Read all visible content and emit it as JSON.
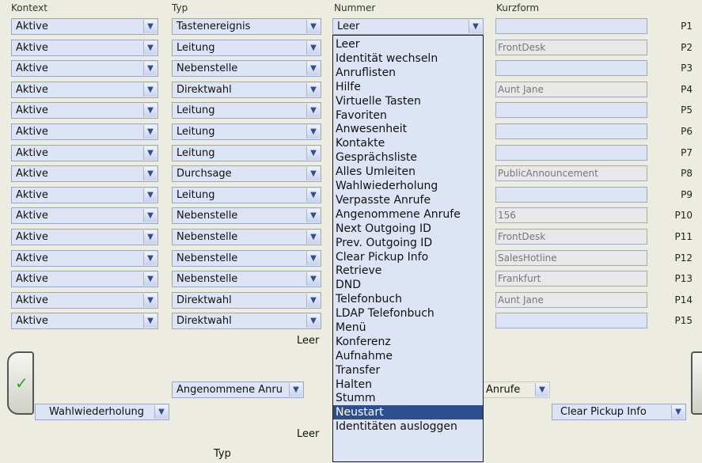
{
  "headers": {
    "kontext": "Kontext",
    "typ": "Typ",
    "nummer": "Nummer",
    "kurzform": "Kurzform"
  },
  "rows": [
    {
      "kontext": "Aktive",
      "typ": "Tastenereignis",
      "kurzform": "",
      "p": "P1"
    },
    {
      "kontext": "Aktive",
      "typ": "Leitung",
      "kurzform": "FrontDesk",
      "p": "P2"
    },
    {
      "kontext": "Aktive",
      "typ": "Nebenstelle",
      "kurzform": "",
      "p": "P3"
    },
    {
      "kontext": "Aktive",
      "typ": "Direktwahl",
      "kurzform": "Aunt Jane",
      "p": "P4"
    },
    {
      "kontext": "Aktive",
      "typ": "Leitung",
      "kurzform": "",
      "p": "P5"
    },
    {
      "kontext": "Aktive",
      "typ": "Leitung",
      "kurzform": "",
      "p": "P6"
    },
    {
      "kontext": "Aktive",
      "typ": "Leitung",
      "kurzform": "",
      "p": "P7"
    },
    {
      "kontext": "Aktive",
      "typ": "Durchsage",
      "kurzform": "PublicAnnouncement",
      "p": "P8"
    },
    {
      "kontext": "Aktive",
      "typ": "Leitung",
      "kurzform": "",
      "p": "P9"
    },
    {
      "kontext": "Aktive",
      "typ": "Nebenstelle",
      "kurzform": "156",
      "p": "P10"
    },
    {
      "kontext": "Aktive",
      "typ": "Nebenstelle",
      "kurzform": "FrontDesk",
      "p": "P11"
    },
    {
      "kontext": "Aktive",
      "typ": "Nebenstelle",
      "kurzform": "SalesHotline",
      "p": "P12"
    },
    {
      "kontext": "Aktive",
      "typ": "Nebenstelle",
      "kurzform": "Frankfurt",
      "p": "P13"
    },
    {
      "kontext": "Aktive",
      "typ": "Direktwahl",
      "kurzform": "Aunt Jane",
      "p": "P14"
    },
    {
      "kontext": "Aktive",
      "typ": "Direktwahl",
      "kurzform": "",
      "p": "P15"
    }
  ],
  "nummer_selected": "Leer",
  "dropdown_options": [
    "Leer",
    "Identität wechseln",
    "Anruflisten",
    "Hilfe",
    "Virtuelle Tasten",
    "Favoriten",
    "Anwesenheit",
    "Kontakte",
    "Gesprächsliste",
    "Alles Umleiten",
    "Wahlwiederholung",
    "Verpasste Anrufe",
    "Angenommene Anrufe",
    "Next Outgoing ID",
    "Prev. Outgoing ID",
    "Clear Pickup Info",
    "Retrieve",
    "DND",
    "Telefonbuch",
    "LDAP Telefonbuch",
    "Menü",
    "Konferenz",
    "Aufnahme",
    "Transfer",
    "Halten",
    "Stumm",
    "Neustart",
    "Identitäten ausloggen"
  ],
  "highlighted_option": "Neustart",
  "lower": {
    "leer_top": "Leer",
    "angenommene_select": "Angenommene Anru",
    "anrufe_fragment": "Anrufe",
    "wahlwiederholung_select": "Wahlwiederholung",
    "clear_pickup_select": "Clear Pickup Info",
    "leer_bottom": "Leer",
    "typ_label": "Typ"
  },
  "colors": {
    "select_bg": "#dde4f5",
    "highlight": "#2e4f8d",
    "page_bg": "#ecece0"
  }
}
